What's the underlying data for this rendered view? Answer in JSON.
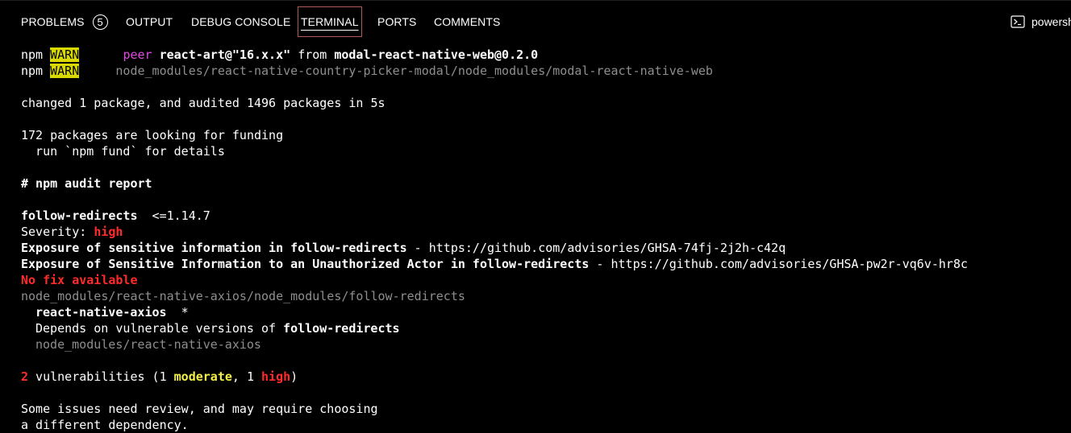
{
  "panel": {
    "header_scrap": "'     `'\"'\" `   `'  \"\"  '    `  '\"'`  '  \"  \"'  \" '\"'`'  \"'\"  `   '\"\"'`  \"'\"'  `'\"    \"'`\"'`\"'  '\"'\"'`'\"\"'  ",
    "tabs": [
      {
        "label": "PROBLEMS",
        "badge": "5"
      },
      {
        "label": "OUTPUT"
      },
      {
        "label": "DEBUG CONSOLE"
      },
      {
        "label": "TERMINAL"
      },
      {
        "label": "PORTS"
      },
      {
        "label": "COMMENTS"
      }
    ],
    "terminal_picker": {
      "icon": "terminal-icon",
      "label": "powersh"
    }
  },
  "terminal": {
    "l1": {
      "npm": "npm",
      "warn": "WARN",
      "peer": "peer",
      "pkg": "react-art@\"16.x.x\"",
      "from": "from",
      "src": "modal-react-native-web@0.2.0"
    },
    "l2": {
      "npm": "npm",
      "warn": "WARN",
      "path": "node_modules/react-native-country-picker-modal/node_modules/modal-react-native-web"
    },
    "changed": "changed 1 package, and audited 1496 packages in 5s",
    "funding": "172 packages are looking for funding",
    "fund_hint": "  run `npm fund` for details",
    "audit_header": "# npm audit report",
    "pkg_name": "follow-redirects",
    "pkg_range": "  <=1.14.7",
    "severity_label": "Severity: ",
    "severity_value": "high",
    "adv1": {
      "title": "Exposure of sensitive information in follow-redirects",
      "sep": " - ",
      "url": "https://github.com/advisories/GHSA-74fj-2j2h-c42q"
    },
    "adv2": {
      "title": "Exposure of Sensitive Information to an Unauthorized Actor in follow-redirects",
      "sep": " - ",
      "url": "https://github.com/advisories/GHSA-pw2r-vq6v-hr8c"
    },
    "no_fix": "No fix available",
    "path1": "node_modules/react-native-axios/node_modules/follow-redirects",
    "dep_name": "react-native-axios",
    "dep_range": "  *",
    "depends_prefix": "Depends on vulnerable versions of ",
    "depends_pkg": "follow-redirects",
    "path2": "node_modules/react-native-axios",
    "vuln": {
      "count": "2",
      "mid": " vulnerabilities (1 ",
      "moderate": "moderate",
      "comma": ", 1 ",
      "high": "high",
      "end": ")"
    },
    "review1": "Some issues need review, and may require choosing",
    "review2": "a different dependency."
  },
  "colors": {
    "background": "#000000",
    "text": "#ffffff",
    "dim": "#8e8e8e",
    "red": "#ff2b2b",
    "magenta": "#e548e5",
    "yellow": "#f3f04a",
    "warn_bg": "#d9d900"
  }
}
